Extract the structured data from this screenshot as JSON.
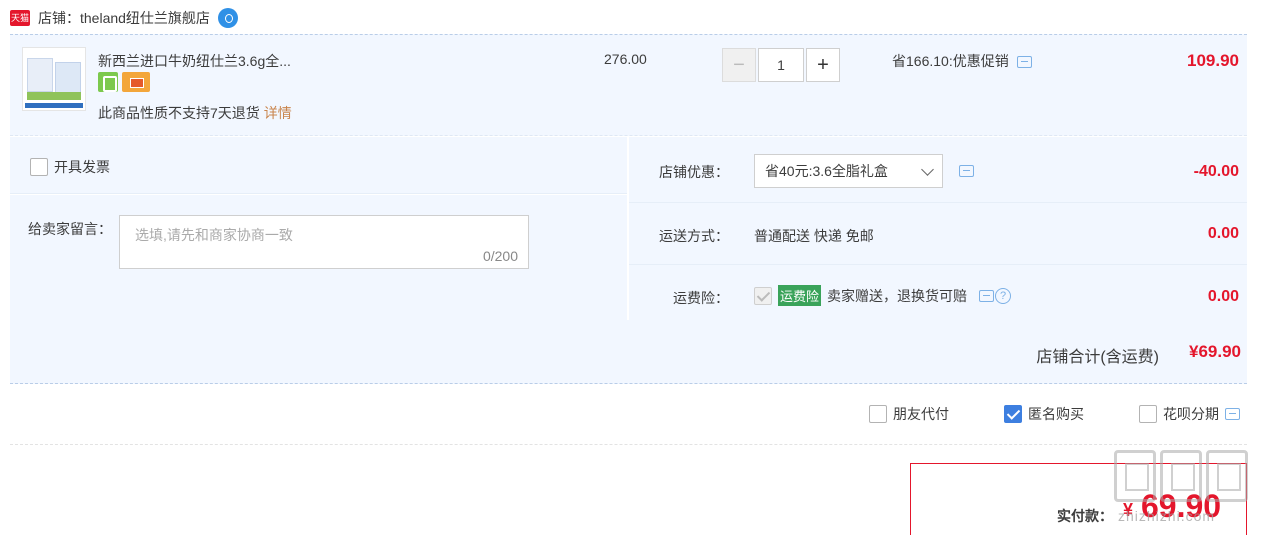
{
  "shop": {
    "badge": "天猫",
    "label": "店铺：theland纽仕兰旗舰店"
  },
  "item": {
    "title": "新西兰进口牛奶纽仕兰3.6g全...",
    "note": "此商品性质不支持7天退货",
    "note_link": "详情",
    "price": "276.00",
    "quantity": "1",
    "qty_minus": "−",
    "qty_plus": "+",
    "saving": "省166.10:优惠促销",
    "total": "109.90"
  },
  "invoice": {
    "label": "开具发票",
    "checked": false
  },
  "message": {
    "label": "给卖家留言：",
    "placeholder": "选填,请先和商家协商一致",
    "count": "0/200"
  },
  "store_discount": {
    "label": "店铺优惠：",
    "selected": "省40元:3.6全脂礼盒",
    "amount": "-40.00"
  },
  "shipping": {
    "label": "运送方式：",
    "value": "普通配送 快递 免邮",
    "amount": "0.00"
  },
  "insurance": {
    "label": "运费险：",
    "tag": "运费险",
    "desc": "卖家赠送，退换货可赔",
    "help": "?",
    "amount": "0.00"
  },
  "shop_total": {
    "label": "店铺合计(含运费)",
    "value": "¥69.90"
  },
  "pay_options": [
    {
      "label": "朋友代付",
      "checked": false
    },
    {
      "label": "匿名购买",
      "checked": true
    },
    {
      "label": "花呗分期",
      "checked": false
    }
  ],
  "final": {
    "label": "实付款：",
    "currency": "¥",
    "value": "69.90"
  },
  "watermark": {
    "text": "zhizhizhi.com"
  },
  "colors": {
    "accent_red": "#e4162c",
    "panel_bg": "#f2f7ff",
    "link_orange": "#c9854d",
    "check_blue": "#3d7fe0",
    "insurance_green": "#3aa35a"
  }
}
